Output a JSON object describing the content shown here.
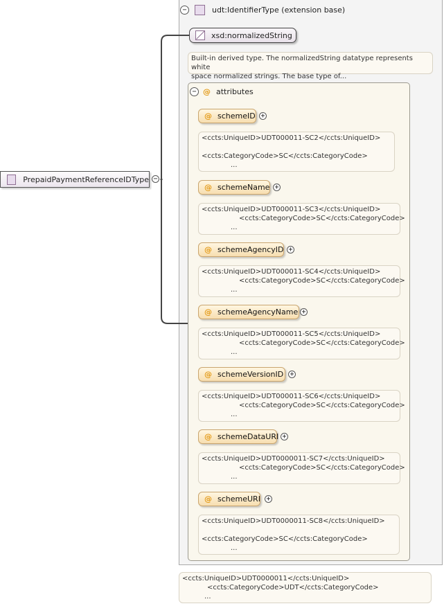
{
  "extension": {
    "title": "udt:IdentifierType (extension base)",
    "toggle": "−"
  },
  "base_type": {
    "name": "xsd:normalizedString",
    "doc": [
      "Built-in derived type. The normalizedString datatype represents white",
      "space normalized strings. The base type of..."
    ]
  },
  "attributes": {
    "title": "attributes",
    "toggle": "−",
    "icon": "@",
    "items": [
      {
        "name": "schemeID",
        "toggle": "+",
        "doc": [
          "<ccts:UniqueID>UDT000011-SC2</ccts:UniqueID>",
          "",
          "<ccts:CategoryCode>SC</ccts:CategoryCode>",
          "..."
        ]
      },
      {
        "name": "schemeName",
        "toggle": "+",
        "doc": [
          "<ccts:UniqueID>UDT000011-SC3</ccts:UniqueID>",
          "<ccts:CategoryCode>SC</ccts:CategoryCode>",
          "..."
        ]
      },
      {
        "name": "schemeAgencyID",
        "toggle": "+",
        "doc": [
          "<ccts:UniqueID>UDT000011-SC4</ccts:UniqueID>",
          "<ccts:CategoryCode>SC</ccts:CategoryCode>",
          "..."
        ]
      },
      {
        "name": "schemeAgencyName",
        "toggle": "+",
        "doc": [
          "<ccts:UniqueID>UDT000011-SC5</ccts:UniqueID>",
          "<ccts:CategoryCode>SC</ccts:CategoryCode>",
          "..."
        ]
      },
      {
        "name": "schemeVersionID",
        "toggle": "+",
        "doc": [
          "<ccts:UniqueID>UDT000011-SC6</ccts:UniqueID>",
          "<ccts:CategoryCode>SC</ccts:CategoryCode>",
          "..."
        ]
      },
      {
        "name": "schemeDataURI",
        "toggle": "+",
        "doc": [
          "<ccts:UniqueID>UDT0000011-SC7</ccts:UniqueID>",
          "<ccts:CategoryCode>SC</ccts:CategoryCode>",
          "..."
        ]
      },
      {
        "name": "schemeURI",
        "toggle": "+",
        "doc": [
          "<ccts:UniqueID>UDT0000011-SC8</ccts:UniqueID>",
          "",
          "<ccts:CategoryCode>SC</ccts:CategoryCode>",
          "..."
        ]
      }
    ]
  },
  "root": {
    "name": "PrepaidPaymentReferenceIDType",
    "toggle": "−"
  },
  "type_doc": [
    "<ccts:UniqueID>UDT0000011</ccts:UniqueID>",
    "<ccts:CategoryCode>UDT</ccts:CategoryCode>",
    "..."
  ]
}
